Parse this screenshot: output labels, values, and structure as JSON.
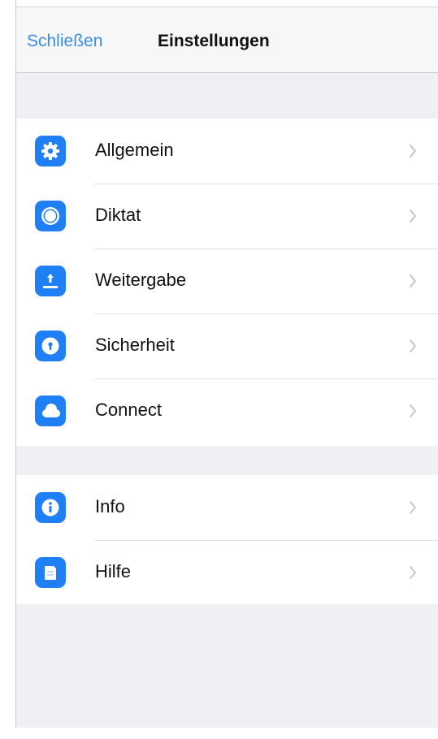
{
  "navbar": {
    "close_label": "Schließen",
    "title": "Einstellungen"
  },
  "settings": {
    "group1": [
      {
        "label": "Allgemein",
        "icon": "gear-icon"
      },
      {
        "label": "Diktat",
        "icon": "record-icon"
      },
      {
        "label": "Weitergabe",
        "icon": "upload-icon"
      },
      {
        "label": "Sicherheit",
        "icon": "lock-icon"
      },
      {
        "label": "Connect",
        "icon": "cloud-icon"
      }
    ],
    "group2": [
      {
        "label": "Info",
        "icon": "info-icon"
      },
      {
        "label": "Hilfe",
        "icon": "help-book-icon"
      }
    ]
  },
  "colors": {
    "accent": "#3a8ee6",
    "icon_background": "#1f7ff5",
    "background": "#efeff4"
  }
}
